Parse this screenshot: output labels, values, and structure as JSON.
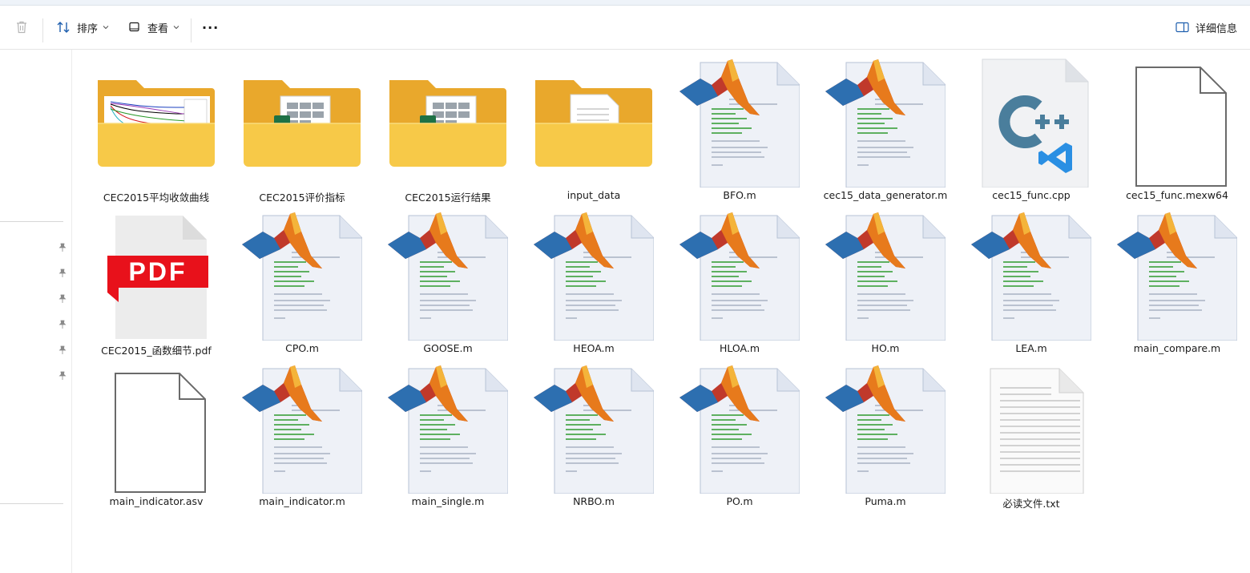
{
  "toolbar": {
    "sort_label": "排序",
    "view_label": "查看",
    "more_label": "···",
    "details_label": "详细信息"
  },
  "files": [
    {
      "name": "CEC2015平均收敛曲线",
      "type": "folder-chart"
    },
    {
      "name": "CEC2015评价指标",
      "type": "folder-excel"
    },
    {
      "name": "CEC2015运行结果",
      "type": "folder-excel"
    },
    {
      "name": "input_data",
      "type": "folder-doc"
    },
    {
      "name": "BFO.m",
      "type": "matlab"
    },
    {
      "name": "cec15_data_generator.m",
      "type": "matlab"
    },
    {
      "name": "cec15_func.cpp",
      "type": "cpp"
    },
    {
      "name": "cec15_func.mexw64",
      "type": "blank"
    },
    {
      "name": "CEC2015_函数细节.pdf",
      "type": "pdf"
    },
    {
      "name": "CPO.m",
      "type": "matlab"
    },
    {
      "name": "GOOSE.m",
      "type": "matlab"
    },
    {
      "name": "HEOA.m",
      "type": "matlab"
    },
    {
      "name": "HLOA.m",
      "type": "matlab"
    },
    {
      "name": "HO.m",
      "type": "matlab"
    },
    {
      "name": "LEA.m",
      "type": "matlab"
    },
    {
      "name": "main_compare.m",
      "type": "matlab"
    },
    {
      "name": "main_indicator.asv",
      "type": "blank"
    },
    {
      "name": "main_indicator.m",
      "type": "matlab"
    },
    {
      "name": "main_single.m",
      "type": "matlab"
    },
    {
      "name": "NRBO.m",
      "type": "matlab"
    },
    {
      "name": "PO.m",
      "type": "matlab"
    },
    {
      "name": "Puma.m",
      "type": "matlab"
    },
    {
      "name": "必读文件.txt",
      "type": "text"
    }
  ],
  "pdf_badge": "PDF",
  "cpp_badge": "C++",
  "colors": {
    "folder": "#f7c948",
    "folder_back": "#e9a82c",
    "excel": "#1e7145",
    "pdf_red": "#e8111b",
    "cpp_blue": "#4a7e9c",
    "vscode_blue": "#2a8fe3"
  }
}
